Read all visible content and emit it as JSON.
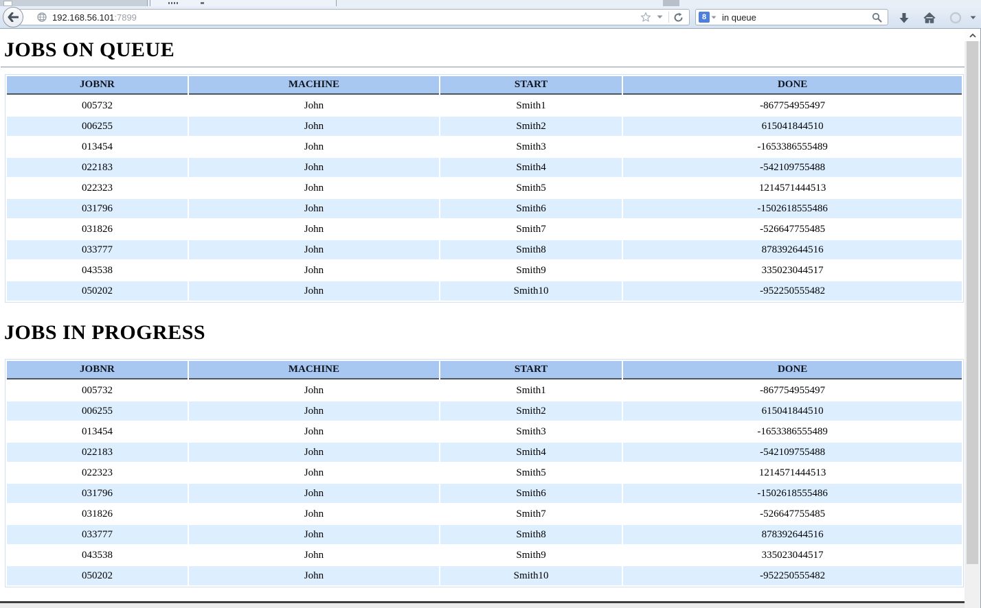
{
  "browser": {
    "toolbar": {
      "url_host": "192.168.56.101",
      "url_port": ":7899",
      "search_value": "in queue",
      "search_engine_badge": "8"
    }
  },
  "page": {
    "sections": [
      {
        "heading": "JOBS ON QUEUE",
        "columns": [
          "JOBNR",
          "MACHINE",
          "START",
          "DONE"
        ],
        "rows": [
          [
            "005732",
            "John",
            "Smith1",
            "-867754955497"
          ],
          [
            "006255",
            "John",
            "Smith2",
            "615041844510"
          ],
          [
            "013454",
            "John",
            "Smith3",
            "-1653386555489"
          ],
          [
            "022183",
            "John",
            "Smith4",
            "-542109755488"
          ],
          [
            "022323",
            "John",
            "Smith5",
            "1214571444513"
          ],
          [
            "031796",
            "John",
            "Smith6",
            "-1502618555486"
          ],
          [
            "031826",
            "John",
            "Smith7",
            "-526647755485"
          ],
          [
            "033777",
            "John",
            "Smith8",
            "878392644516"
          ],
          [
            "043538",
            "John",
            "Smith9",
            "335023044517"
          ],
          [
            "050202",
            "John",
            "Smith10",
            "-952250555482"
          ]
        ]
      },
      {
        "heading": "JOBS IN PROGRESS",
        "columns": [
          "JOBNR",
          "MACHINE",
          "START",
          "DONE"
        ],
        "rows": [
          [
            "005732",
            "John",
            "Smith1",
            "-867754955497"
          ],
          [
            "006255",
            "John",
            "Smith2",
            "615041844510"
          ],
          [
            "013454",
            "John",
            "Smith3",
            "-1653386555489"
          ],
          [
            "022183",
            "John",
            "Smith4",
            "-542109755488"
          ],
          [
            "022323",
            "John",
            "Smith5",
            "1214571444513"
          ],
          [
            "031796",
            "John",
            "Smith6",
            "-1502618555486"
          ],
          [
            "031826",
            "John",
            "Smith7",
            "-526647755485"
          ],
          [
            "033777",
            "John",
            "Smith8",
            "878392644516"
          ],
          [
            "043538",
            "John",
            "Smith9",
            "335023044517"
          ],
          [
            "050202",
            "John",
            "Smith10",
            "-952250555482"
          ]
        ]
      }
    ]
  },
  "colors": {
    "table_header_bg": "#a9c8f1",
    "table_alt_row_bg": "#ddeeff",
    "search_engine_badge_bg": "#4d7fe0",
    "toolbar_bg": "#dde7f3"
  }
}
